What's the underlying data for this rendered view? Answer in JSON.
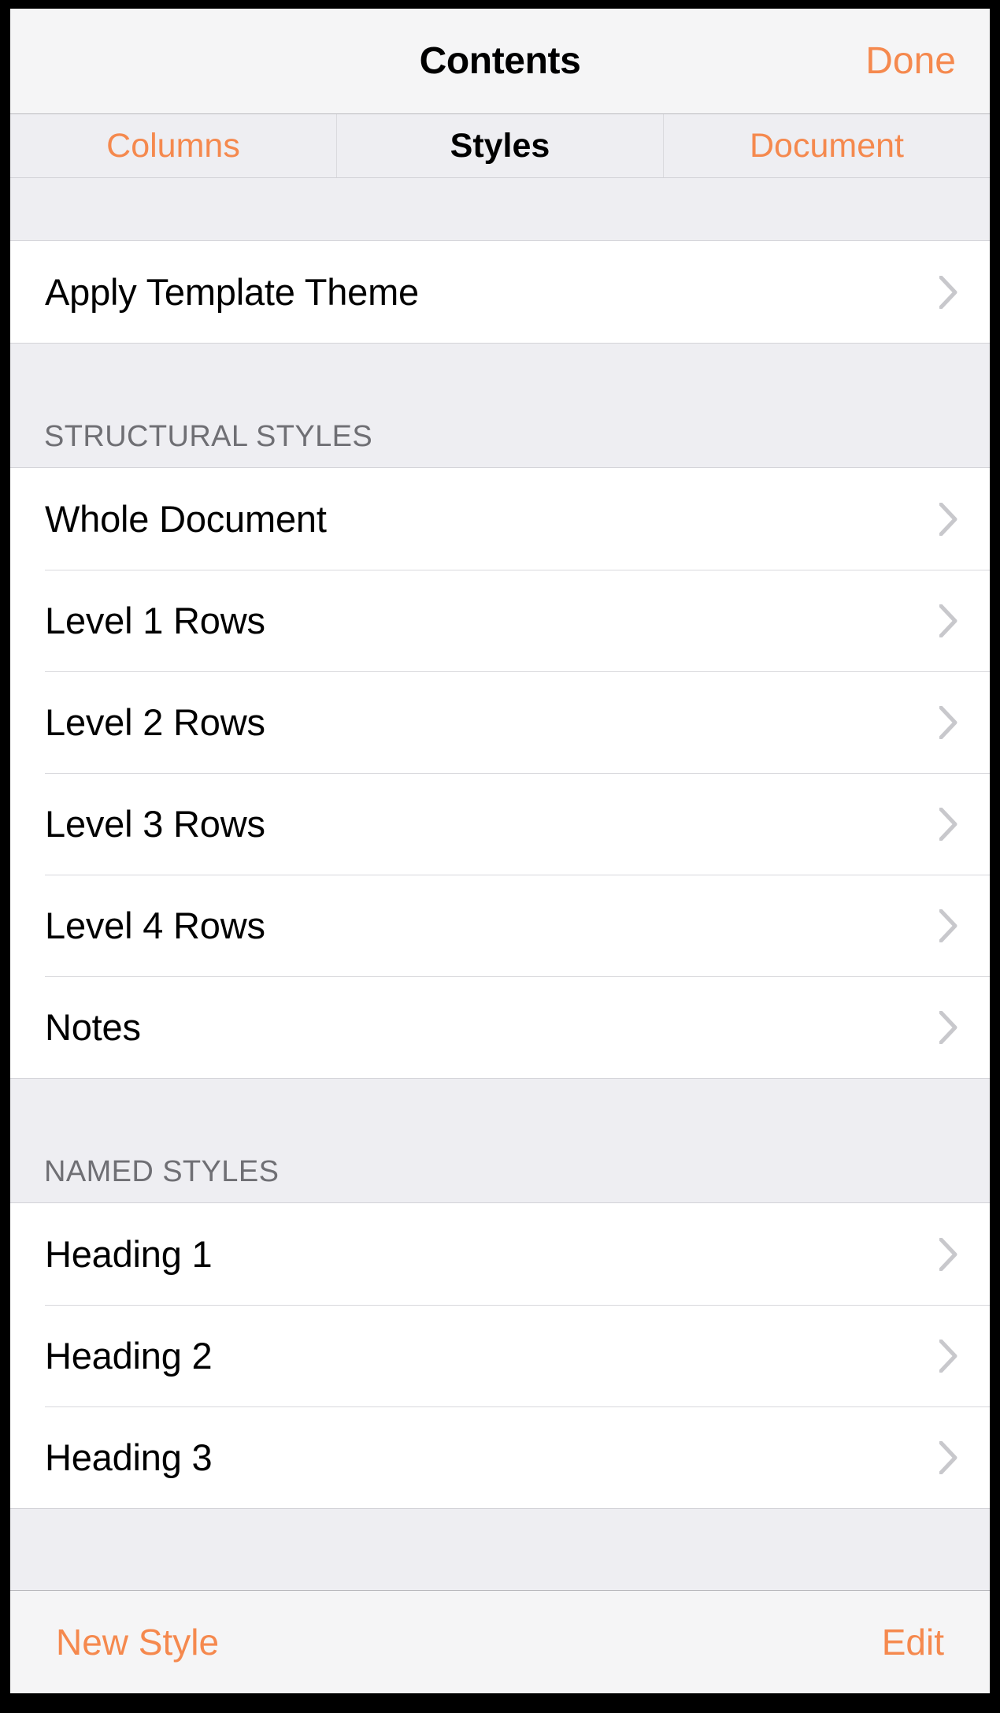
{
  "navbar": {
    "title": "Contents",
    "done_label": "Done"
  },
  "tabs": [
    {
      "label": "Columns",
      "active": false
    },
    {
      "label": "Styles",
      "active": true
    },
    {
      "label": "Document",
      "active": false
    }
  ],
  "theme_group": {
    "rows": [
      {
        "label": "Apply Template Theme"
      }
    ]
  },
  "structural_section": {
    "header": "STRUCTURAL STYLES",
    "rows": [
      {
        "label": "Whole Document"
      },
      {
        "label": "Level 1 Rows"
      },
      {
        "label": "Level 2 Rows"
      },
      {
        "label": "Level 3 Rows"
      },
      {
        "label": "Level 4 Rows"
      },
      {
        "label": "Notes"
      }
    ]
  },
  "named_section": {
    "header": "NAMED STYLES",
    "rows": [
      {
        "label": "Heading 1"
      },
      {
        "label": "Heading 2"
      },
      {
        "label": "Heading 3"
      }
    ]
  },
  "toolbar": {
    "new_style_label": "New Style",
    "edit_label": "Edit"
  },
  "colors": {
    "accent": "#f5894e",
    "group_background": "#eeeef2",
    "row_background": "#ffffff",
    "bar_background": "#f5f5f6",
    "separator": "#d8d8dc",
    "section_header_text": "#6f6f74",
    "chevron": "#c8c8cc"
  },
  "icons": {
    "disclosure": "chevron-right-icon"
  }
}
